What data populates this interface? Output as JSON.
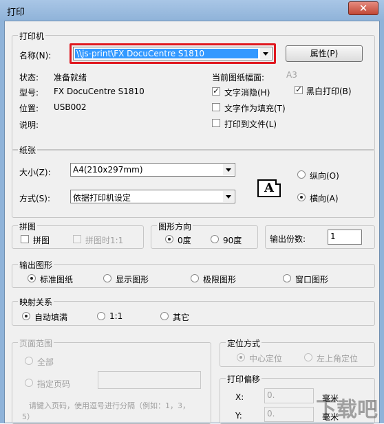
{
  "window": {
    "title": "打印",
    "close_label": "✕"
  },
  "printer_group": {
    "title": "打印机",
    "name_label": "名称(N):",
    "printer_name": "\\\\js-print\\FX DocuCentre S1810",
    "properties_button": "属性(P)",
    "status_label": "状态:",
    "status_value": "准备就绪",
    "model_label": "型号:",
    "model_value": "FX DocuCentre S1810",
    "location_label": "位置:",
    "location_value": "USB002",
    "comment_label": "说明:",
    "current_paper_label": "当前图纸幅面:",
    "current_paper_value": "A3",
    "text_antialias": {
      "label": "文字消隐(H)",
      "checked": true
    },
    "mono_print": {
      "label": "黑白打印(B)",
      "checked": true
    },
    "text_as_fill": {
      "label": "文字作为填充(T)",
      "checked": false
    },
    "print_to_file": {
      "label": "打印到文件(L)",
      "checked": false
    }
  },
  "paper_group": {
    "title": "纸张",
    "size_label": "大小(Z):",
    "size_value": "A4(210x297mm)",
    "mode_label": "方式(S):",
    "mode_value": "依据打印机设定",
    "portrait_label": "纵向(O)",
    "landscape_label": "横向(A)",
    "orientation": "landscape",
    "icon_letter": "A"
  },
  "tile_group": {
    "title": "拼图",
    "tile_label": "拼图",
    "tile_time_label": "拼图时1:1"
  },
  "graphic_direction_group": {
    "title": "图形方向",
    "deg0_label": "0度",
    "deg90_label": "90度",
    "selected": "0度"
  },
  "copies": {
    "label": "输出份数:",
    "value": "1"
  },
  "output_graphic_group": {
    "title": "输出图形",
    "options": [
      "标准图纸",
      "显示图形",
      "极限图形",
      "窗口图形"
    ],
    "selected": "标准图纸"
  },
  "mapping_group": {
    "title": "映射关系",
    "options": [
      "自动填满",
      "1:1",
      "其它"
    ],
    "selected": "自动填满"
  },
  "page_range_group": {
    "title": "页面范围",
    "all_label": "全部",
    "specify_label": "指定页码",
    "hint_line1": "请键入页码，使用逗号进行分隔（例如：1，3，",
    "hint_line2": "5）"
  },
  "positioning_group": {
    "title": "定位方式",
    "center_label": "中心定位",
    "top_left_label": "左上角定位"
  },
  "offset_group": {
    "title": "打印偏移",
    "x_label": "X:",
    "x_value": "0.",
    "y_label": "Y:",
    "y_value": "0.",
    "unit_label": "毫米"
  },
  "watermark": "下载吧"
}
